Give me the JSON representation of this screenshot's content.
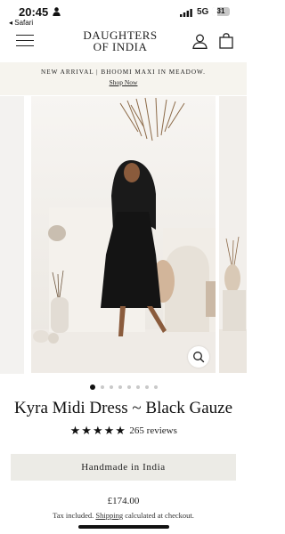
{
  "status_bar": {
    "time": "20:45",
    "back_label": "◂ Safari",
    "network": "5G",
    "battery_level": "31",
    "battery_fraction": 0.31
  },
  "header": {
    "logo_line1": "DAUGHTERS",
    "logo_line2": "OF INDIA",
    "icons": [
      "menu-icon",
      "account-icon",
      "bag-icon"
    ]
  },
  "announcement": {
    "text": "NEW ARRIVAL | BHOOMI MAXI IN MEADOW.",
    "link": "Shop Now"
  },
  "gallery": {
    "image_count": 8,
    "active_index": 0
  },
  "product": {
    "title": "Kyra Midi Dress ~ Black Gauze",
    "rating": 5,
    "reviews": "265 reviews",
    "badge_button": "Handmade in India",
    "price": "£174.00",
    "tax_prefix": "Tax included.",
    "tax_link": "Shipping",
    "tax_suffix": "calculated at checkout."
  },
  "colors": {
    "announcement_bg": "#f6f4ee",
    "button_bg": "#ecebe6",
    "text": "#1e1e1e"
  }
}
